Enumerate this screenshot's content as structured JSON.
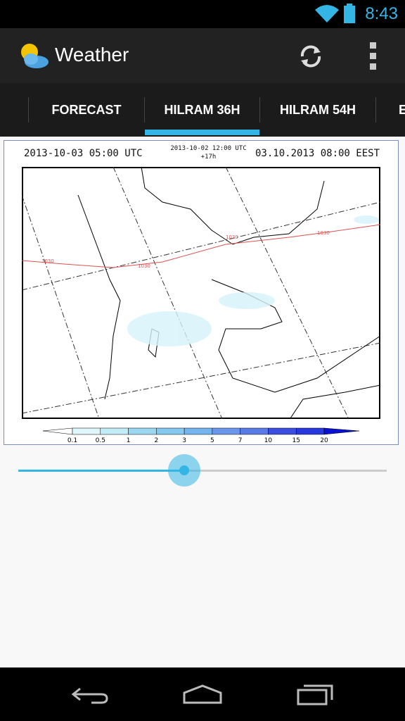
{
  "status_bar": {
    "time": "8:43",
    "icons": [
      "wifi-icon",
      "battery-icon"
    ]
  },
  "action_bar": {
    "title": "Weather",
    "app_icon": "sun-cloud-icon",
    "actions": [
      "refresh-icon",
      "overflow-menu-icon"
    ]
  },
  "tabs": [
    {
      "label": "FORECAST",
      "selected": false
    },
    {
      "label": "HILRAM 36H",
      "selected": true
    },
    {
      "label": "HILRAM 54H",
      "selected": false
    },
    {
      "label": "E",
      "selected": false
    }
  ],
  "map": {
    "valid_utc": "2013-10-03 05:00 UTC",
    "run_time": "2013-10-02 12:00 UTC",
    "lead": "+17h",
    "valid_local": "03.10.2013 08:00 EEST",
    "isobar_labels": [
      "1030",
      "1030",
      "1030",
      "1030"
    ],
    "isobar_color": "#e05050",
    "legend_ticks": [
      "0.1",
      "0.5",
      "1",
      "2",
      "3",
      "5",
      "7",
      "10",
      "15",
      "20"
    ],
    "legend_colors": [
      "#ffffff",
      "#dff6fb",
      "#c2ecf8",
      "#9ad8f2",
      "#86c9f0",
      "#74b5ef",
      "#6b96eb",
      "#5a7ae6",
      "#3c4ee0",
      "#2838dc",
      "#0a10d0"
    ]
  },
  "slider": {
    "value_fraction": 0.45,
    "color": "#33b5e5"
  },
  "nav_bar": [
    "back-icon",
    "home-icon",
    "recent-apps-icon"
  ]
}
